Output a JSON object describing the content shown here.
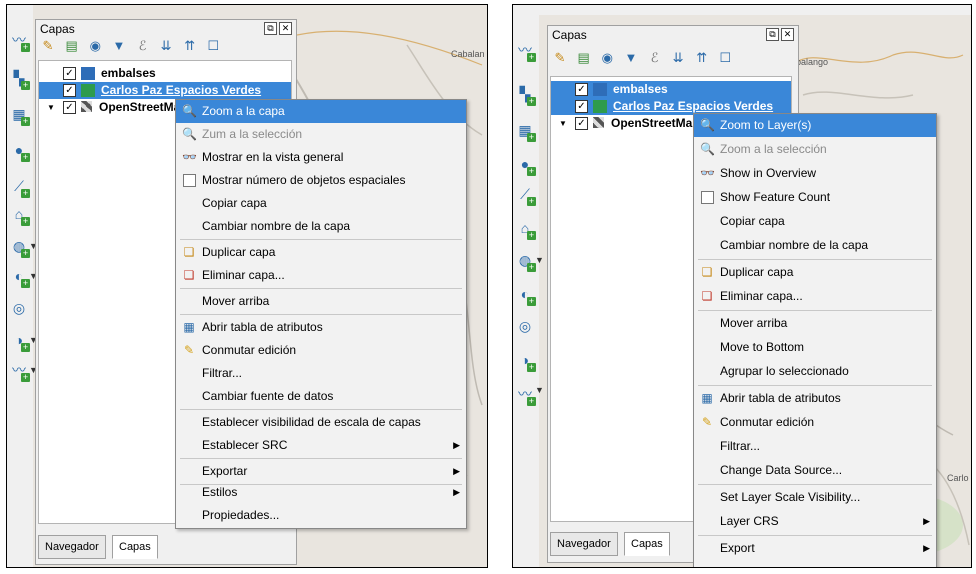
{
  "left": {
    "panel_title": "Capas",
    "map_label": "Cabalan",
    "layers": [
      {
        "name": "embalses",
        "checked": "✓",
        "color": "#2e6db8"
      },
      {
        "name": "Carlos Paz Espacios Verdes",
        "checked": "✓",
        "color": "#2e9b4c"
      },
      {
        "name": "OpenStreetMap",
        "checked": "✓",
        "expand": "▼"
      }
    ],
    "tabs": [
      "Navegador",
      "Capas"
    ],
    "menu": [
      {
        "label": "Zoom a la capa",
        "icon": "zoom-icon",
        "state": "highlighted"
      },
      {
        "label": "Zum a la selección",
        "icon": "zoom-selection-icon",
        "state": "disabled"
      },
      {
        "label": "Mostrar en la vista general",
        "icon": "overview-icon"
      },
      {
        "label": "Mostrar número de objetos espaciales",
        "icon": "checkbox"
      },
      {
        "label": "Copiar capa"
      },
      {
        "label": "Cambiar nombre de la capa"
      },
      {
        "label": "Duplicar capa",
        "icon": "duplicate-icon"
      },
      {
        "label": "Eliminar capa...",
        "icon": "remove-icon"
      },
      {
        "label": "Mover arriba"
      },
      {
        "label": "Abrir tabla de atributos",
        "icon": "table-icon"
      },
      {
        "label": "Conmutar edición",
        "icon": "pencil-icon"
      },
      {
        "label": "Filtrar..."
      },
      {
        "label": "Cambiar fuente de datos"
      },
      {
        "label": "Establecer visibilidad de escala de capas"
      },
      {
        "label": "Establecer SRC",
        "submenu": "▶"
      },
      {
        "label": "Exportar",
        "submenu": "▶"
      },
      {
        "label": "Estilos",
        "submenu": "▶"
      },
      {
        "label": "Propiedades..."
      }
    ]
  },
  "right": {
    "panel_title": "Capas",
    "map_label": "abalango",
    "map_label2": "Carlo",
    "layers": [
      {
        "name": "embalses",
        "checked": "✓",
        "color": "#2e6db8"
      },
      {
        "name": "Carlos Paz Espacios Verdes",
        "checked": "✓",
        "color": "#2e9b4c"
      },
      {
        "name": "OpenStreetMap",
        "checked": "✓",
        "expand": "▼"
      }
    ],
    "tabs": [
      "Navegador",
      "Capas"
    ],
    "menu": [
      {
        "label": "Zoom to Layer(s)",
        "icon": "zoom-icon",
        "state": "highlighted"
      },
      {
        "label": "Zoom a la selección",
        "icon": "zoom-selection-icon",
        "state": "disabled"
      },
      {
        "label": "Show in Overview",
        "icon": "overview-icon"
      },
      {
        "label": "Show Feature Count",
        "icon": "checkbox"
      },
      {
        "label": "Copiar capa"
      },
      {
        "label": "Cambiar nombre de la capa"
      },
      {
        "label": "Duplicar capa",
        "icon": "duplicate-icon"
      },
      {
        "label": "Eliminar capa...",
        "icon": "remove-icon"
      },
      {
        "label": "Mover arriba"
      },
      {
        "label": "Move to Bottom"
      },
      {
        "label": "Agrupar lo seleccionado"
      },
      {
        "label": "Abrir tabla de atributos",
        "icon": "table-icon"
      },
      {
        "label": "Conmutar edición",
        "icon": "pencil-icon"
      },
      {
        "label": "Filtrar..."
      },
      {
        "label": "Change Data Source..."
      },
      {
        "label": "Set Layer Scale Visibility..."
      },
      {
        "label": "Layer CRS",
        "submenu": "▶"
      },
      {
        "label": "Export",
        "submenu": "▶"
      }
    ]
  },
  "colors": {
    "highlight": "#3a87d8",
    "menu_bg": "#f2f2f2"
  }
}
